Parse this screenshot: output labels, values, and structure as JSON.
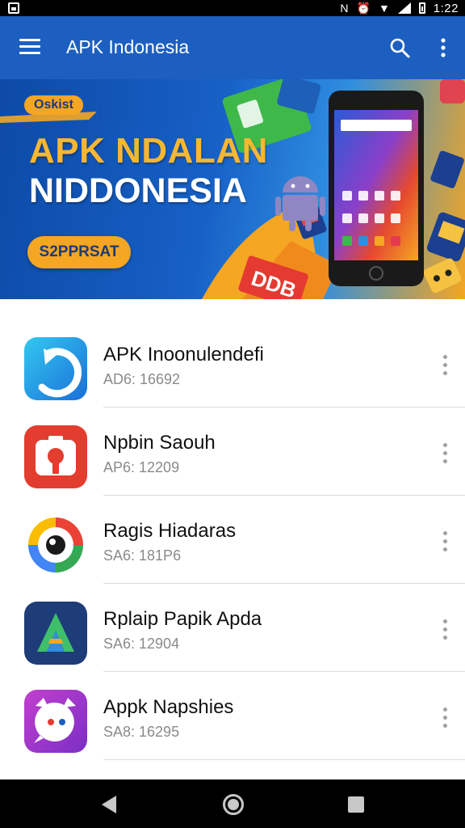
{
  "status_bar": {
    "time": "1:22",
    "icons": [
      "screenshot-icon",
      "nfc-icon",
      "alarm-icon",
      "wifi-icon",
      "signal-icon",
      "battery-icon"
    ]
  },
  "app_bar": {
    "title": "APK Indonesia",
    "menu_icon": "hamburger-menu-icon",
    "search_icon": "search-icon",
    "more_icon": "more-vertical-icon",
    "color": "#1c5fc1"
  },
  "banner": {
    "badge": "Oskist",
    "title_line1": "APK NDALAN",
    "title_line2": "NIDDONESIA",
    "button_label": "S2PPRSAT",
    "accent_color": "#f5a623"
  },
  "apps": [
    {
      "name": "APK Inoonulendefi",
      "size": "AD6: 16692",
      "icon": "arrow-app-icon"
    },
    {
      "name": "Npbin Saouh",
      "size": "AP6: 12209",
      "icon": "camera-app-icon"
    },
    {
      "name": "Ragis Hiadaras",
      "size": "SA6: 181P6",
      "icon": "lens-app-icon"
    },
    {
      "name": "Rplaip Papik Apda",
      "size": "SA6: 12904",
      "icon": "letter-a-app-icon"
    },
    {
      "name": "Appk Napshies",
      "size": "SA8: 16295",
      "icon": "chat-app-icon"
    }
  ],
  "nav_bar": {
    "back_icon": "back-triangle-icon",
    "home_icon": "home-circle-icon",
    "recents_icon": "recents-square-icon"
  }
}
